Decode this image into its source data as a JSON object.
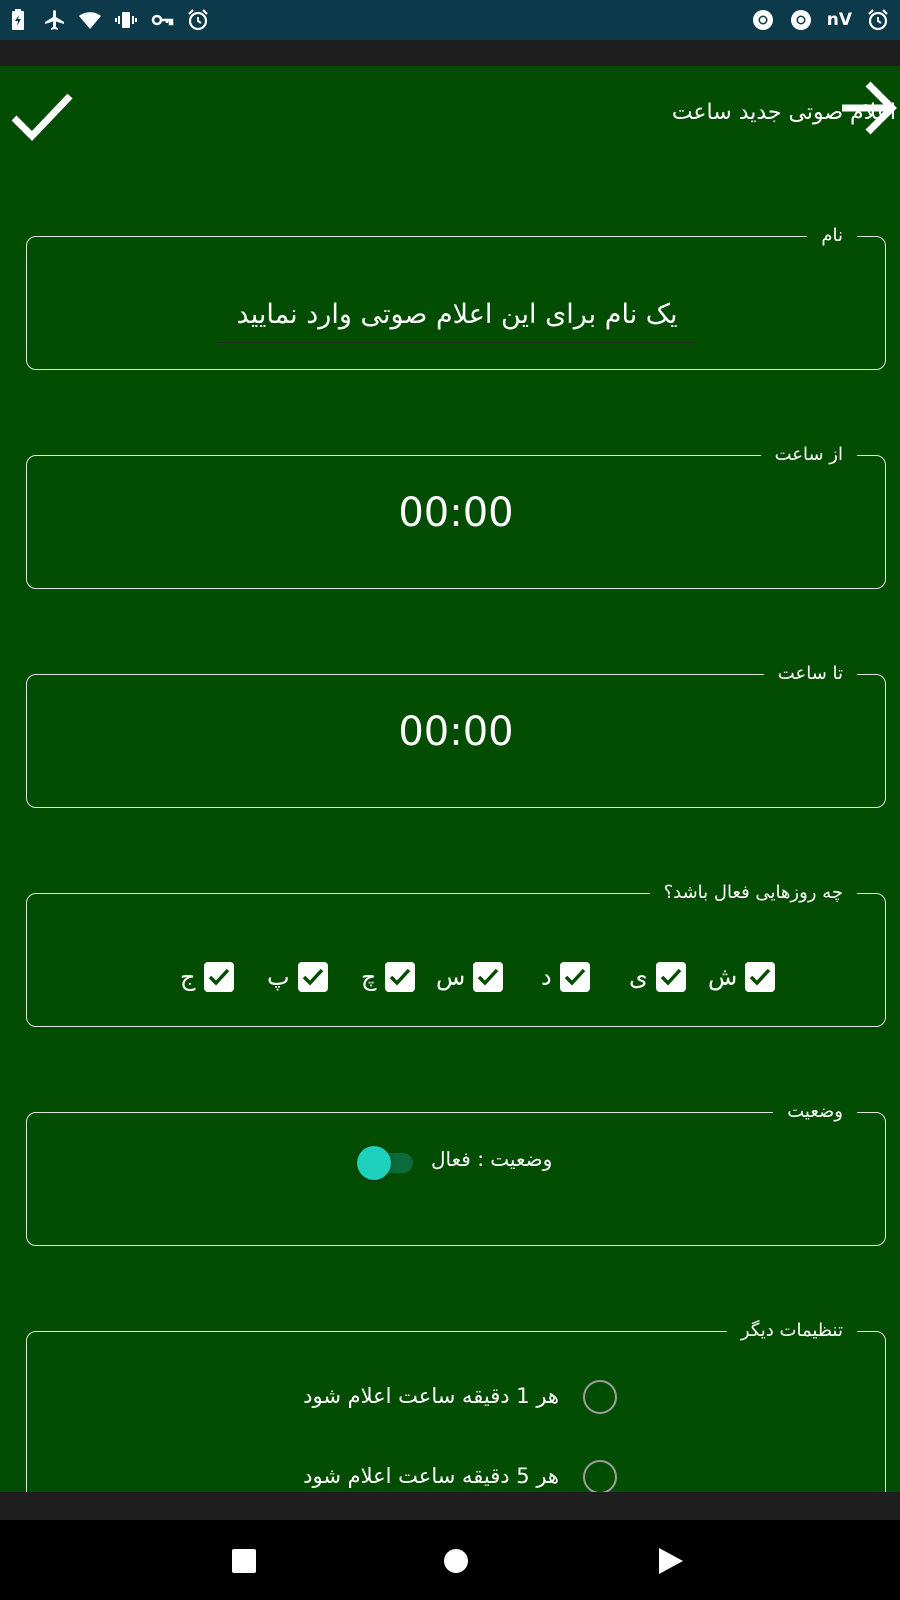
{
  "status_bar": {
    "left_icons": [
      "battery-icon",
      "airplane-icon",
      "wifi-icon",
      "vibrate-icon",
      "vpn-key-icon",
      "alarm-icon"
    ],
    "right_icons": [
      "chrome-icon",
      "chrome-icon",
      "alarm-icon"
    ],
    "right_text": "nV"
  },
  "header": {
    "title": "اعلام صوتی جدید ساعت"
  },
  "name_section": {
    "legend": "نام",
    "placeholder": "یک نام برای این اعلام صوتی وارد نمایید"
  },
  "from_section": {
    "legend": "از ساعت",
    "value": "00:00"
  },
  "to_section": {
    "legend": "تا ساعت",
    "value": "00:00"
  },
  "days_section": {
    "legend": "چه روزهایی فعال باشد؟",
    "days": [
      {
        "label": "ش",
        "checked": true
      },
      {
        "label": "ی",
        "checked": true
      },
      {
        "label": "د",
        "checked": true
      },
      {
        "label": "س",
        "checked": true
      },
      {
        "label": "چ",
        "checked": true
      },
      {
        "label": "پ",
        "checked": true
      },
      {
        "label": "ج",
        "checked": true
      }
    ]
  },
  "status_section": {
    "legend": "وضعیت",
    "label": "وضعیت : فعال",
    "switch_on": true
  },
  "other_section": {
    "legend": "تنظیمات دیگر",
    "options": [
      {
        "label": "هر 1 دقیقه ساعت اعلام شود",
        "selected": false
      },
      {
        "label": "هر 5 دقیقه ساعت اعلام شود",
        "selected": false
      }
    ]
  },
  "colors": {
    "app_background": "#034d03",
    "switch_thumb": "#1dd1bd",
    "status_bar": "#0d3a4a"
  }
}
